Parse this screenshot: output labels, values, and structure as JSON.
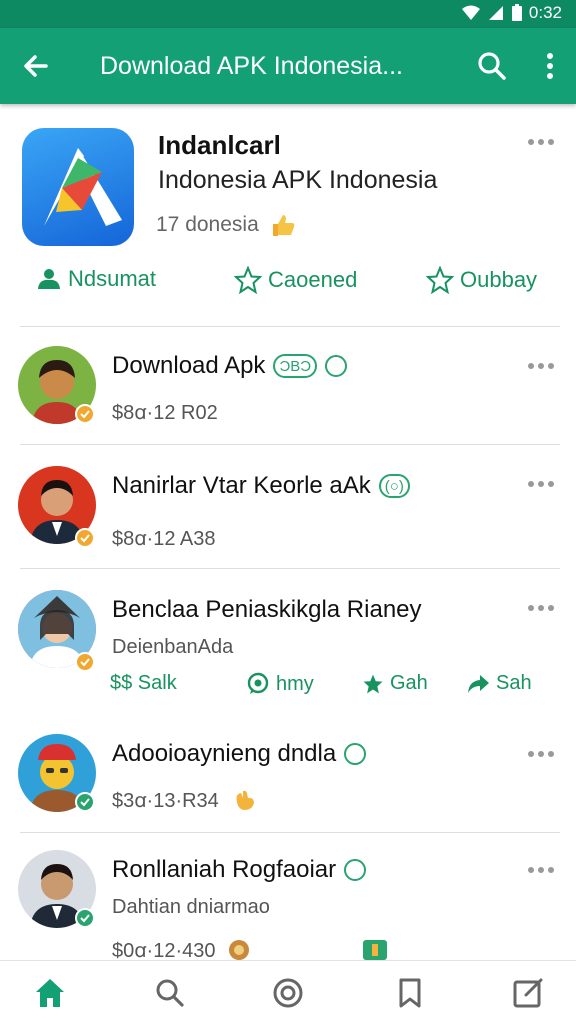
{
  "status": {
    "time": "0:32"
  },
  "appbar": {
    "title": "Download APK Indonesia..."
  },
  "app": {
    "name": "Indanlcarl",
    "subtitle": "Indonesia APK Indonesia",
    "meta": "17 donesia",
    "actions": [
      {
        "label": "Ndsumat",
        "icon": "person-icon"
      },
      {
        "label": "Caoened",
        "icon": "star-icon"
      },
      {
        "label": "Oubbay",
        "icon": "star-icon"
      }
    ]
  },
  "items": [
    {
      "title": "Download Apk",
      "title_tag": "ƆBƆ",
      "sub": "$8ꭤ·12 R02",
      "badge_color": "#f0a830"
    },
    {
      "title": "Nanirlar Vtar Keorle aAk",
      "title_tag": "(○)",
      "sub": "$8ꭤ·12 A38",
      "badge_color": "#f0a830"
    },
    {
      "title": "Benclaa Peniaskikgla Rianey",
      "sub": "DeienbanAda",
      "badge_color": "#f0a830"
    },
    {
      "title": "Adooioaynieng dndla",
      "sub": "$3ꭤ·13·R34",
      "badge_color": "#2aa36f"
    },
    {
      "title": "Ronllaniah Rogfaoiar",
      "sub": "Dahtian dniarmao",
      "sub2": "$0ꭤ·12·430",
      "badge_color": "#2aa36f"
    }
  ],
  "social": [
    {
      "label": "$$ Salk",
      "icon": "dollar-icon"
    },
    {
      "label": "hmy",
      "icon": "whatsapp-icon"
    },
    {
      "label": "Gah",
      "icon": "star-icon"
    },
    {
      "label": "Sah",
      "icon": "share-icon"
    }
  ],
  "nav": [
    "home-icon",
    "search-icon",
    "discover-icon",
    "bookmark-icon",
    "edit-icon"
  ],
  "colors": {
    "appbar": "#12a074",
    "statusbar": "#0e8a63",
    "accent": "#18935f"
  }
}
